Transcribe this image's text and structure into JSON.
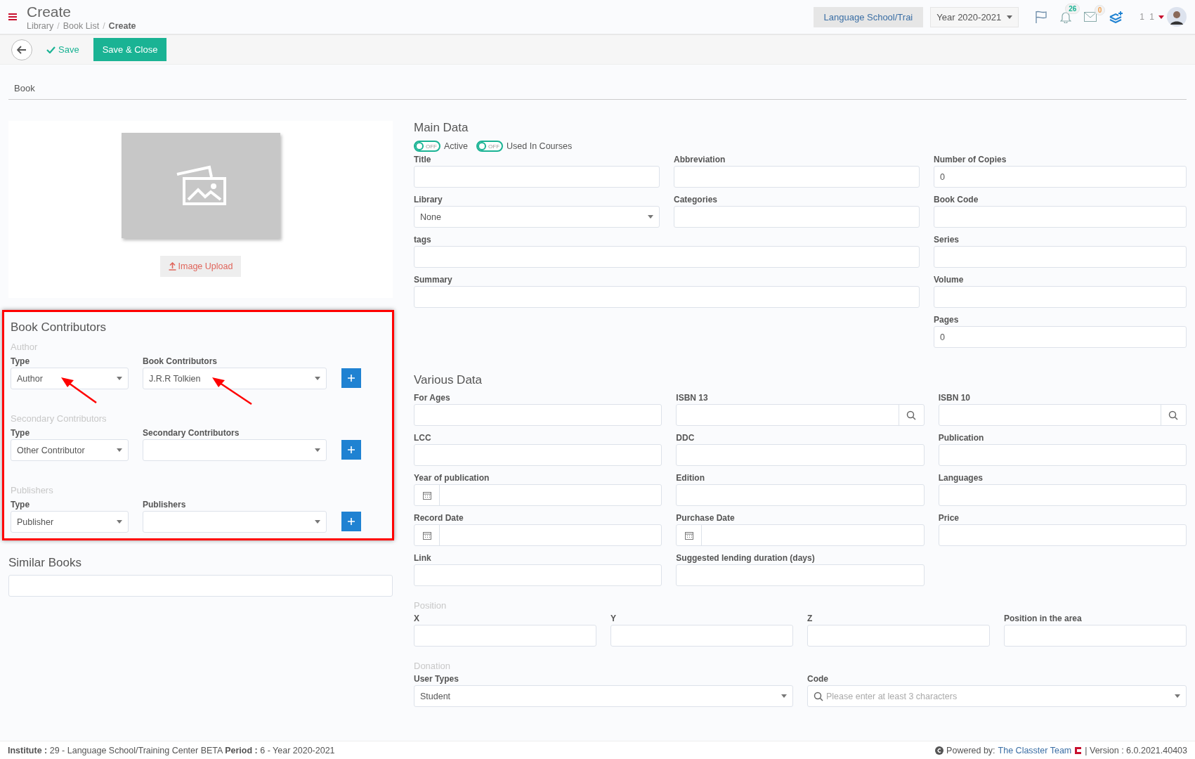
{
  "header": {
    "title": "Create",
    "separator": "/",
    "breadcrumb": [
      {
        "label": "Library",
        "current": false
      },
      {
        "label": "Book List",
        "current": false
      },
      {
        "label": "Create",
        "current": true
      }
    ],
    "school": "Language School/Trai",
    "year": "Year 2020-2021",
    "notifications": "26",
    "messages": "0",
    "user": "1 1"
  },
  "toolbar": {
    "save": "Save",
    "save_close": "Save & Close"
  },
  "tab": "Book",
  "image_upload": "Image Upload",
  "contributors": {
    "title": "Book Contributors",
    "highlighted": true,
    "groups": [
      {
        "heading": "Author",
        "type_label": "Type",
        "type_value": "Author",
        "list_label": "Book Contributors",
        "list_value": "J.R.R Tolkien",
        "arrows": true
      },
      {
        "heading": "Secondary Contributors",
        "type_label": "Type",
        "type_value": "Other Contributor",
        "list_label": "Secondary Contributors",
        "arrows": false
      },
      {
        "heading": "Publishers",
        "type_label": "Type",
        "type_value": "Publisher",
        "list_label": "Publishers",
        "arrows": false
      }
    ]
  },
  "similar_books": {
    "title": "Similar Books"
  },
  "main_data": {
    "title": "Main Data",
    "toggles": [
      {
        "label": "Active",
        "on": false,
        "text": "OFF"
      },
      {
        "label": "Used In Courses",
        "on": false,
        "text": "OFF"
      }
    ],
    "left_rows": [
      [
        {
          "label": "Title",
          "kind": "text"
        },
        {
          "label": "Abbreviation",
          "kind": "text"
        }
      ],
      [
        {
          "label": "Library",
          "kind": "select",
          "value": "None"
        },
        {
          "label": "Categories",
          "kind": "text"
        }
      ],
      [
        {
          "label": "tags",
          "kind": "text"
        }
      ],
      [
        {
          "label": "Summary",
          "kind": "text"
        }
      ]
    ],
    "right_fields": [
      {
        "label": "Number of Copies",
        "kind": "text",
        "value": "0"
      },
      {
        "label": "Book Code",
        "kind": "text"
      },
      {
        "label": "Series",
        "kind": "text"
      },
      {
        "label": "Volume",
        "kind": "text"
      },
      {
        "label": "Pages",
        "kind": "text",
        "value": "0"
      }
    ]
  },
  "various_data": {
    "title": "Various Data",
    "rows": [
      [
        {
          "label": "For Ages",
          "kind": "text"
        },
        {
          "label": "ISBN 13",
          "kind": "search"
        },
        {
          "label": "ISBN 10",
          "kind": "search"
        }
      ],
      [
        {
          "label": "LCC",
          "kind": "text"
        },
        {
          "label": "DDC",
          "kind": "text"
        },
        {
          "label": "Publication",
          "kind": "text"
        }
      ],
      [
        {
          "label": "Year of publication",
          "kind": "date"
        },
        {
          "label": "Edition",
          "kind": "text"
        },
        {
          "label": "Languages",
          "kind": "text"
        }
      ],
      [
        {
          "label": "Record Date",
          "kind": "date"
        },
        {
          "label": "Purchase Date",
          "kind": "date"
        },
        {
          "label": "Price",
          "kind": "text"
        }
      ],
      [
        {
          "label": "Link",
          "kind": "text"
        },
        {
          "label": "Suggested lending duration (days)",
          "kind": "text"
        }
      ]
    ]
  },
  "position": {
    "heading": "Position",
    "fields": [
      {
        "label": "X",
        "kind": "text"
      },
      {
        "label": "Y",
        "kind": "text"
      },
      {
        "label": "Z",
        "kind": "text"
      },
      {
        "label": "Position in the area",
        "kind": "text"
      }
    ]
  },
  "donation": {
    "heading": "Donation",
    "user_types": {
      "label": "User Types",
      "value": "Student"
    },
    "code": {
      "label": "Code",
      "placeholder": "Please enter at least 3 characters"
    }
  },
  "footer": {
    "info": "**Institute :** 29 - Language School/Training Center BETA **Period :** 6 - Year 2020-2021",
    "powered_by": "Powered by:",
    "team": "The Classter Team",
    "version": "| Version : 6.0.2021.40403"
  }
}
